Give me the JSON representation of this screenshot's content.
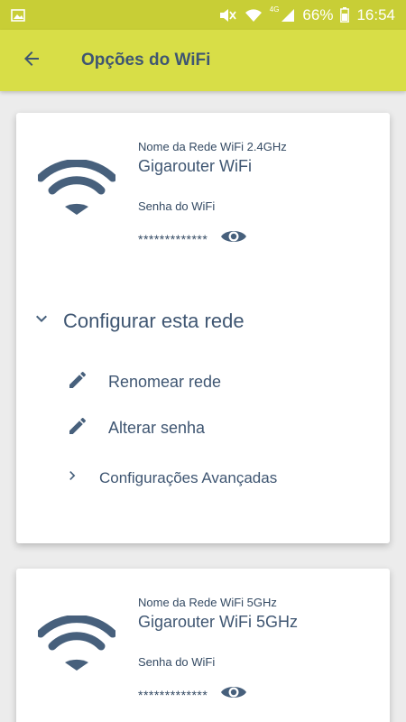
{
  "status_bar": {
    "network": "4G",
    "battery": "66%",
    "time": "16:54"
  },
  "app_bar": {
    "title": "Opções do WiFi"
  },
  "networks": [
    {
      "name_label": "Nome da Rede WiFi 2.4GHz",
      "name": "Gigarouter WiFi",
      "password_label": "Senha do WiFi",
      "password": "*************"
    },
    {
      "name_label": "Nome da Rede WiFi 5GHz",
      "name": "Gigarouter WiFi 5GHz",
      "password_label": "Senha do WiFi",
      "password": "*************"
    }
  ],
  "configure": {
    "title": "Configurar esta rede",
    "rename": "Renomear rede",
    "change_password": "Alterar senha",
    "advanced": "Configurações Avançadas"
  },
  "colors": {
    "accent": "#d8de47",
    "status_bar": "#c8ce36",
    "text": "#3f5672",
    "icon": "#47607c"
  }
}
